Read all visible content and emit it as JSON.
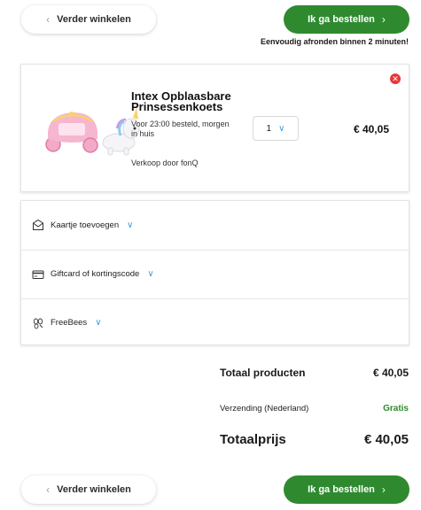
{
  "nav": {
    "back_label": "Verder winkelen",
    "order_label": "Ik ga bestellen",
    "subtitle": "Eenvoudig afronden binnen 2 minuten!"
  },
  "product": {
    "title": "Intex Opblaasbare Prinsessenkoets",
    "delivery": "Voor 23:00 besteld, morgen in huis",
    "seller": "Verkoop door fonQ",
    "quantity": "1",
    "price": "€ 40,05",
    "remove_icon": "close-icon",
    "image_icon": "princess-carriage-image"
  },
  "options": [
    {
      "label": "Kaartje toevoegen",
      "icon": "envelope-card-icon"
    },
    {
      "label": "Giftcard of kortingscode",
      "icon": "credit-card-icon"
    },
    {
      "label": "FreeBees",
      "icon": "bees-icon"
    }
  ],
  "summary": {
    "products_label": "Totaal producten",
    "products_value": "€ 40,05",
    "shipping_label": "Verzending (Nederland)",
    "shipping_value": "Gratis",
    "total_label": "Totaalprijs",
    "total_value": "€ 40,05"
  },
  "colors": {
    "accent_green": "#2f8a2f",
    "chevron_blue": "#3aa0d8",
    "remove_red": "#e5383b"
  }
}
